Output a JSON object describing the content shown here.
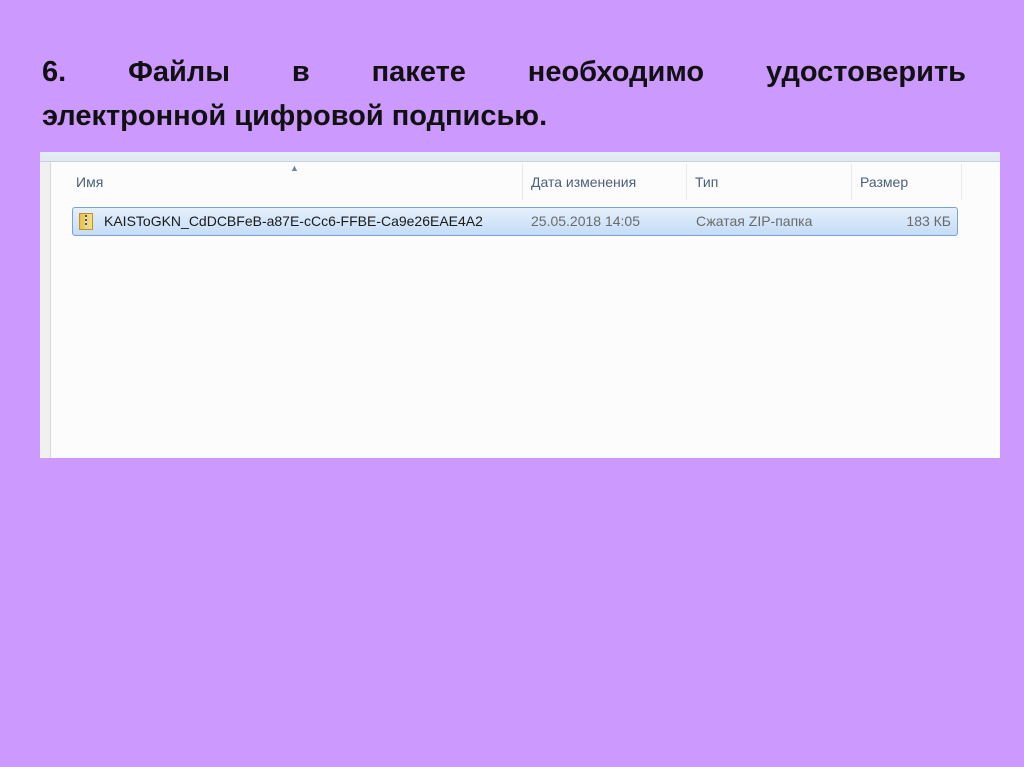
{
  "slide": {
    "title_line1": "6. Файлы в пакете необходимо удостоверить",
    "title_line2": "электронной цифровой подписью."
  },
  "explorer": {
    "columns": [
      "Имя",
      "Дата изменения",
      "Тип",
      "Размер"
    ],
    "files": [
      {
        "name": "KAISToGKN_CdDCBFeB-a87E-cCc6-FFBE-Ca9e26EAE4A2",
        "modified": "25.05.2018 14:05",
        "type": "Сжатая ZIP-папка",
        "size": "183 КБ",
        "icon": "zip-folder-icon"
      }
    ]
  }
}
